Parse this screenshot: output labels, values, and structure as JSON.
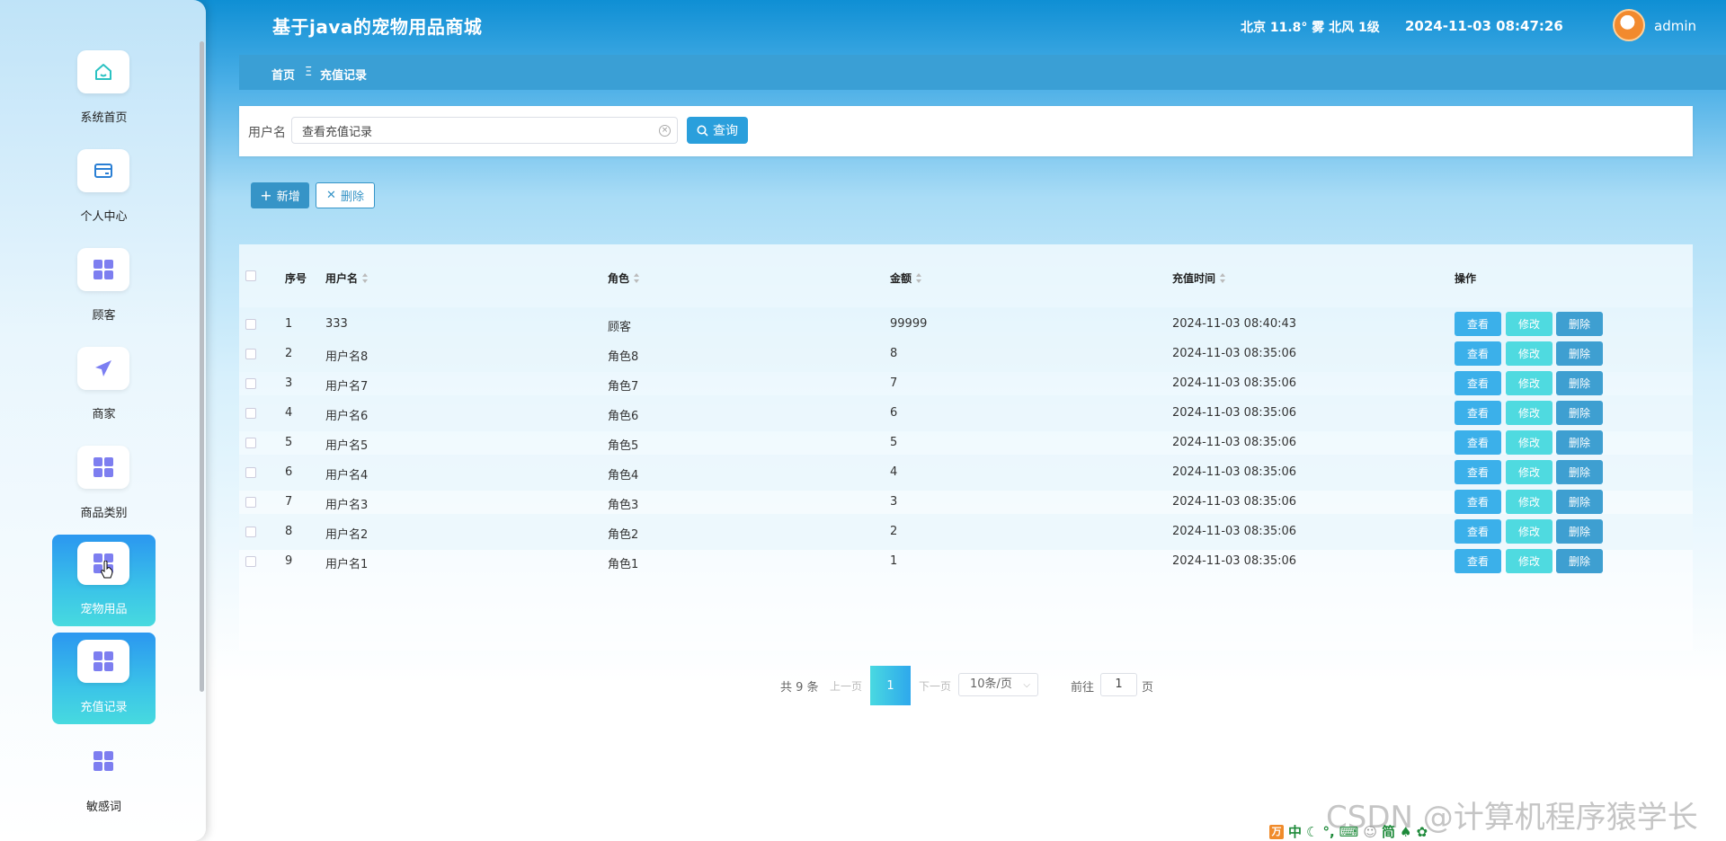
{
  "header": {
    "app_title": "基于java的宠物用品商城",
    "weather": "北京  11.8°  雾  北风  1级",
    "datetime": "2024-11-03 08:47:26",
    "username": "admin"
  },
  "sidebar": {
    "items": [
      {
        "label": "系统首页",
        "icon": "home-icon",
        "active": false
      },
      {
        "label": "个人中心",
        "icon": "wallet-icon",
        "active": false
      },
      {
        "label": "顾客",
        "icon": "grid-icon",
        "active": false
      },
      {
        "label": "商家",
        "icon": "send-icon",
        "active": false
      },
      {
        "label": "商品类别",
        "icon": "grid-icon",
        "active": false
      },
      {
        "label": "宠物用品",
        "icon": "grid-icon",
        "active": true
      },
      {
        "label": "充值记录",
        "icon": "grid-icon",
        "active": true
      },
      {
        "label": "敏感词",
        "icon": "grid-icon",
        "active": false
      }
    ]
  },
  "breadcrumb": {
    "home": "首页",
    "separator": "Ξ",
    "current": "充值记录"
  },
  "search": {
    "label": "用户名",
    "value": "查看充值记录",
    "button": "查询"
  },
  "toolbar": {
    "add_label": "新增",
    "delete_label": "删除"
  },
  "table": {
    "columns": {
      "index": "序号",
      "username": "用户名",
      "role": "角色",
      "amount": "金额",
      "time": "充值时间",
      "actions": "操作"
    },
    "rows": [
      {
        "index": "1",
        "username": "333",
        "role": "顾客",
        "amount": "99999",
        "time": "2024-11-03 08:40:43"
      },
      {
        "index": "2",
        "username": "用户名8",
        "role": "角色8",
        "amount": "8",
        "time": "2024-11-03 08:35:06"
      },
      {
        "index": "3",
        "username": "用户名7",
        "role": "角色7",
        "amount": "7",
        "time": "2024-11-03 08:35:06"
      },
      {
        "index": "4",
        "username": "用户名6",
        "role": "角色6",
        "amount": "6",
        "time": "2024-11-03 08:35:06"
      },
      {
        "index": "5",
        "username": "用户名5",
        "role": "角色5",
        "amount": "5",
        "time": "2024-11-03 08:35:06"
      },
      {
        "index": "6",
        "username": "用户名4",
        "role": "角色4",
        "amount": "4",
        "time": "2024-11-03 08:35:06"
      },
      {
        "index": "7",
        "username": "用户名3",
        "role": "角色3",
        "amount": "3",
        "time": "2024-11-03 08:35:06"
      },
      {
        "index": "8",
        "username": "用户名2",
        "role": "角色2",
        "amount": "2",
        "time": "2024-11-03 08:35:06"
      },
      {
        "index": "9",
        "username": "用户名1",
        "role": "角色1",
        "amount": "1",
        "time": "2024-11-03 08:35:06"
      }
    ],
    "row_actions": {
      "view": "查看",
      "edit": "修改",
      "delete": "删除"
    }
  },
  "pagination": {
    "total": "共 9 条",
    "prev": "上一页",
    "current_page": "1",
    "next": "下一页",
    "page_size": "10条/页",
    "goto_prefix": "前往",
    "goto_value": "1",
    "goto_suffix": "页"
  },
  "watermark": "CSDN @计算机程序猿学长",
  "ime": {
    "logo": "万",
    "mode": "中",
    "simplified": "简"
  },
  "colors": {
    "accent": "#2a9fdc",
    "breadcrumb_bg": "#3a9fd5",
    "view_button": "#3bb0ea",
    "edit_button": "#4fdae0",
    "delete_button": "#3e9fd1"
  }
}
